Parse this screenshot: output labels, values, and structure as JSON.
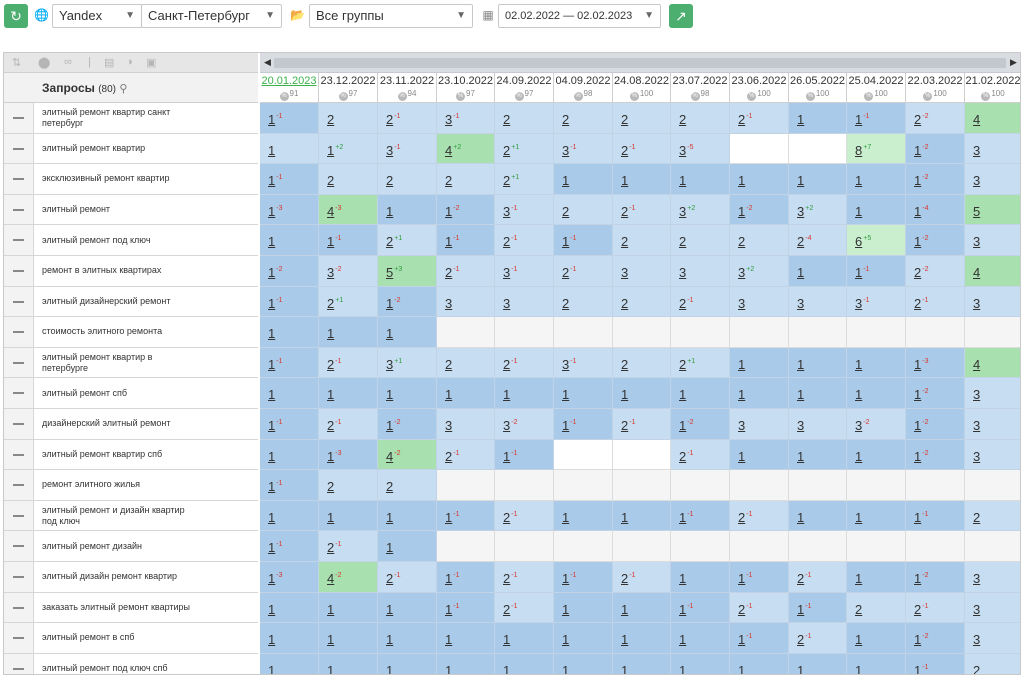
{
  "toolbar": {
    "refresh_icon": "refresh-icon",
    "globe_icon": "globe-icon",
    "engine": "Yandex",
    "region": "Санкт-Петербург",
    "folder_icon": "folder-icon",
    "group": "Все группы",
    "calendar_icon": "calendar-icon",
    "date_range": "02.02.2022 — 02.02.2023",
    "export_icon": "export-icon"
  },
  "queries_header": {
    "title": "Запросы",
    "count": "(80)",
    "search_icon": "search-icon"
  },
  "colors": {
    "blue_dark": "#a9cbe9",
    "blue_light": "#c6ddf2",
    "green": "#a8e0b0",
    "green_light": "#c9efcf",
    "white": "#ffffff",
    "empty": "#f5f5f5"
  },
  "dates": [
    {
      "date": "20.01.2023",
      "vis": "91"
    },
    {
      "date": "23.12.2022",
      "vis": "97"
    },
    {
      "date": "23.11.2022",
      "vis": "94"
    },
    {
      "date": "23.10.2022",
      "vis": "97"
    },
    {
      "date": "24.09.2022",
      "vis": "97"
    },
    {
      "date": "04.09.2022",
      "vis": "98"
    },
    {
      "date": "24.08.2022",
      "vis": "100"
    },
    {
      "date": "23.07.2022",
      "vis": "98"
    },
    {
      "date": "23.06.2022",
      "vis": "100"
    },
    {
      "date": "26.05.2022",
      "vis": "100"
    },
    {
      "date": "25.04.2022",
      "vis": "100"
    },
    {
      "date": "22.03.2022",
      "vis": "100"
    },
    {
      "date": "21.02.2022",
      "vis": "100"
    }
  ],
  "rows": [
    {
      "query": "элитный ремонт квартир санкт петербург",
      "cells": [
        "D1|-1",
        "L2",
        "L2|-1",
        "L3|-1",
        "L2",
        "L2",
        "L2",
        "L2",
        "L2|-1",
        "D1",
        "D1|-1",
        "L2|-2",
        "G4"
      ]
    },
    {
      "query": "элитный ремонт квартир",
      "cells": [
        "L1",
        "L1|+2",
        "L3|-1",
        "G4|+2",
        "L2|+1",
        "L3|-1",
        "L2|-1",
        "L3|-5",
        "W",
        "W",
        "g8|+7",
        "D1|-2",
        "L3"
      ]
    },
    {
      "query": "эксклюзивный ремонт квартир",
      "cells": [
        "D1|-1",
        "L2",
        "L2",
        "L2",
        "L2|+1",
        "D1",
        "D1",
        "D1",
        "D1",
        "D1",
        "D1",
        "D1|-2",
        "L3"
      ]
    },
    {
      "query": "элитный ремонт",
      "cells": [
        "D1|-3",
        "G4|-3",
        "D1",
        "D1|-2",
        "L3|-1",
        "L2",
        "L2|-1",
        "L3|+2",
        "D1|-2",
        "L3|+2",
        "D1",
        "D1|-4",
        "G5"
      ]
    },
    {
      "query": "элитный ремонт под ключ",
      "cells": [
        "D1",
        "D1|-1",
        "L2|+1",
        "D1|-1",
        "L2|-1",
        "D1|-1",
        "L2",
        "L2",
        "L2",
        "L2|-4",
        "g6|+5",
        "D1|-2",
        "L3"
      ]
    },
    {
      "query": "ремонт в элитных квартирах",
      "cells": [
        "D1|-2",
        "L3|-2",
        "G5|+3",
        "L2|-1",
        "L3|-1",
        "L2|-1",
        "L3",
        "L3",
        "L3|+2",
        "D1",
        "D1|-1",
        "L2|-2",
        "G4"
      ]
    },
    {
      "query": "элитный дизайнерский ремонт",
      "cells": [
        "D1|-1",
        "L2|+1",
        "D1|-2",
        "L3",
        "L3",
        "L2",
        "L2",
        "L2|-1",
        "L3",
        "L3",
        "L3|-1",
        "L2|-1",
        "L3"
      ]
    },
    {
      "query": "стоимость элитного ремонта",
      "cells": [
        "D1",
        "D1",
        "D1",
        "E",
        "E",
        "E",
        "E",
        "E",
        "E",
        "E",
        "E",
        "E",
        "E"
      ]
    },
    {
      "query": "элитный ремонт квартир в петербурге",
      "cells": [
        "D1|-1",
        "L2|-1",
        "L3|+1",
        "L2",
        "L2|-1",
        "L3|-1",
        "L2",
        "L2|+1",
        "D1",
        "D1",
        "D1",
        "D1|-3",
        "G4"
      ]
    },
    {
      "query": "элитный ремонт спб",
      "cells": [
        "D1",
        "D1",
        "D1",
        "D1",
        "D1",
        "D1",
        "D1",
        "D1",
        "D1",
        "D1",
        "D1",
        "D1|-2",
        "L3"
      ]
    },
    {
      "query": "дизайнерский элитный ремонт",
      "cells": [
        "D1|-1",
        "L2|-1",
        "D1|-2",
        "L3",
        "L3|-2",
        "D1|-1",
        "L2|-1",
        "D1|-2",
        "L3",
        "L3",
        "L3|-2",
        "D1|-2",
        "L3"
      ]
    },
    {
      "query": "элитный ремонт квартир спб",
      "cells": [
        "D1",
        "D1|-3",
        "G4|-2",
        "L2|-1",
        "D1|-1",
        "W",
        "W",
        "L2|-1",
        "D1",
        "D1",
        "D1",
        "D1|-2",
        "L3"
      ]
    },
    {
      "query": "ремонт элитного жилья",
      "cells": [
        "D1|-1",
        "L2",
        "L2",
        "E",
        "E",
        "E",
        "E",
        "E",
        "E",
        "E",
        "E",
        "E",
        "E"
      ]
    },
    {
      "query": "элитный ремонт и дизайн квартир под ключ",
      "cells": [
        "D1",
        "D1",
        "D1",
        "D1|-1",
        "L2|-1",
        "D1",
        "D1",
        "D1|-1",
        "L2|-1",
        "D1",
        "D1",
        "D1|-1",
        "L2"
      ]
    },
    {
      "query": "элитный ремонт дизайн",
      "cells": [
        "D1|-1",
        "L2|-1",
        "D1",
        "E",
        "E",
        "E",
        "E",
        "E",
        "E",
        "E",
        "E",
        "E",
        "E"
      ]
    },
    {
      "query": "элитный дизайн ремонт квартир",
      "cells": [
        "D1|-3",
        "G4|-2",
        "L2|-1",
        "D1|-1",
        "L2|-1",
        "D1|-1",
        "L2|-1",
        "D1",
        "D1|-1",
        "L2|-1",
        "D1",
        "D1|-2",
        "L3"
      ]
    },
    {
      "query": "заказать элитный ремонт квартиры",
      "cells": [
        "D1",
        "D1",
        "D1",
        "D1|-1",
        "L2|-1",
        "D1",
        "D1",
        "D1|-1",
        "L2|-1",
        "D1|-1",
        "L2",
        "L2|-1",
        "L3"
      ]
    },
    {
      "query": "элитный ремонт в спб",
      "cells": [
        "D1",
        "D1",
        "D1",
        "D1",
        "D1",
        "D1",
        "D1",
        "D1",
        "D1|-1",
        "L2|-1",
        "D1",
        "D1|-2",
        "L3"
      ]
    },
    {
      "query": "элитный ремонт под ключ спб",
      "cells": [
        "D1",
        "D1",
        "D1",
        "D1",
        "D1",
        "D1",
        "D1",
        "D1",
        "D1",
        "D1",
        "D1",
        "D1|-1",
        "L2"
      ]
    }
  ]
}
